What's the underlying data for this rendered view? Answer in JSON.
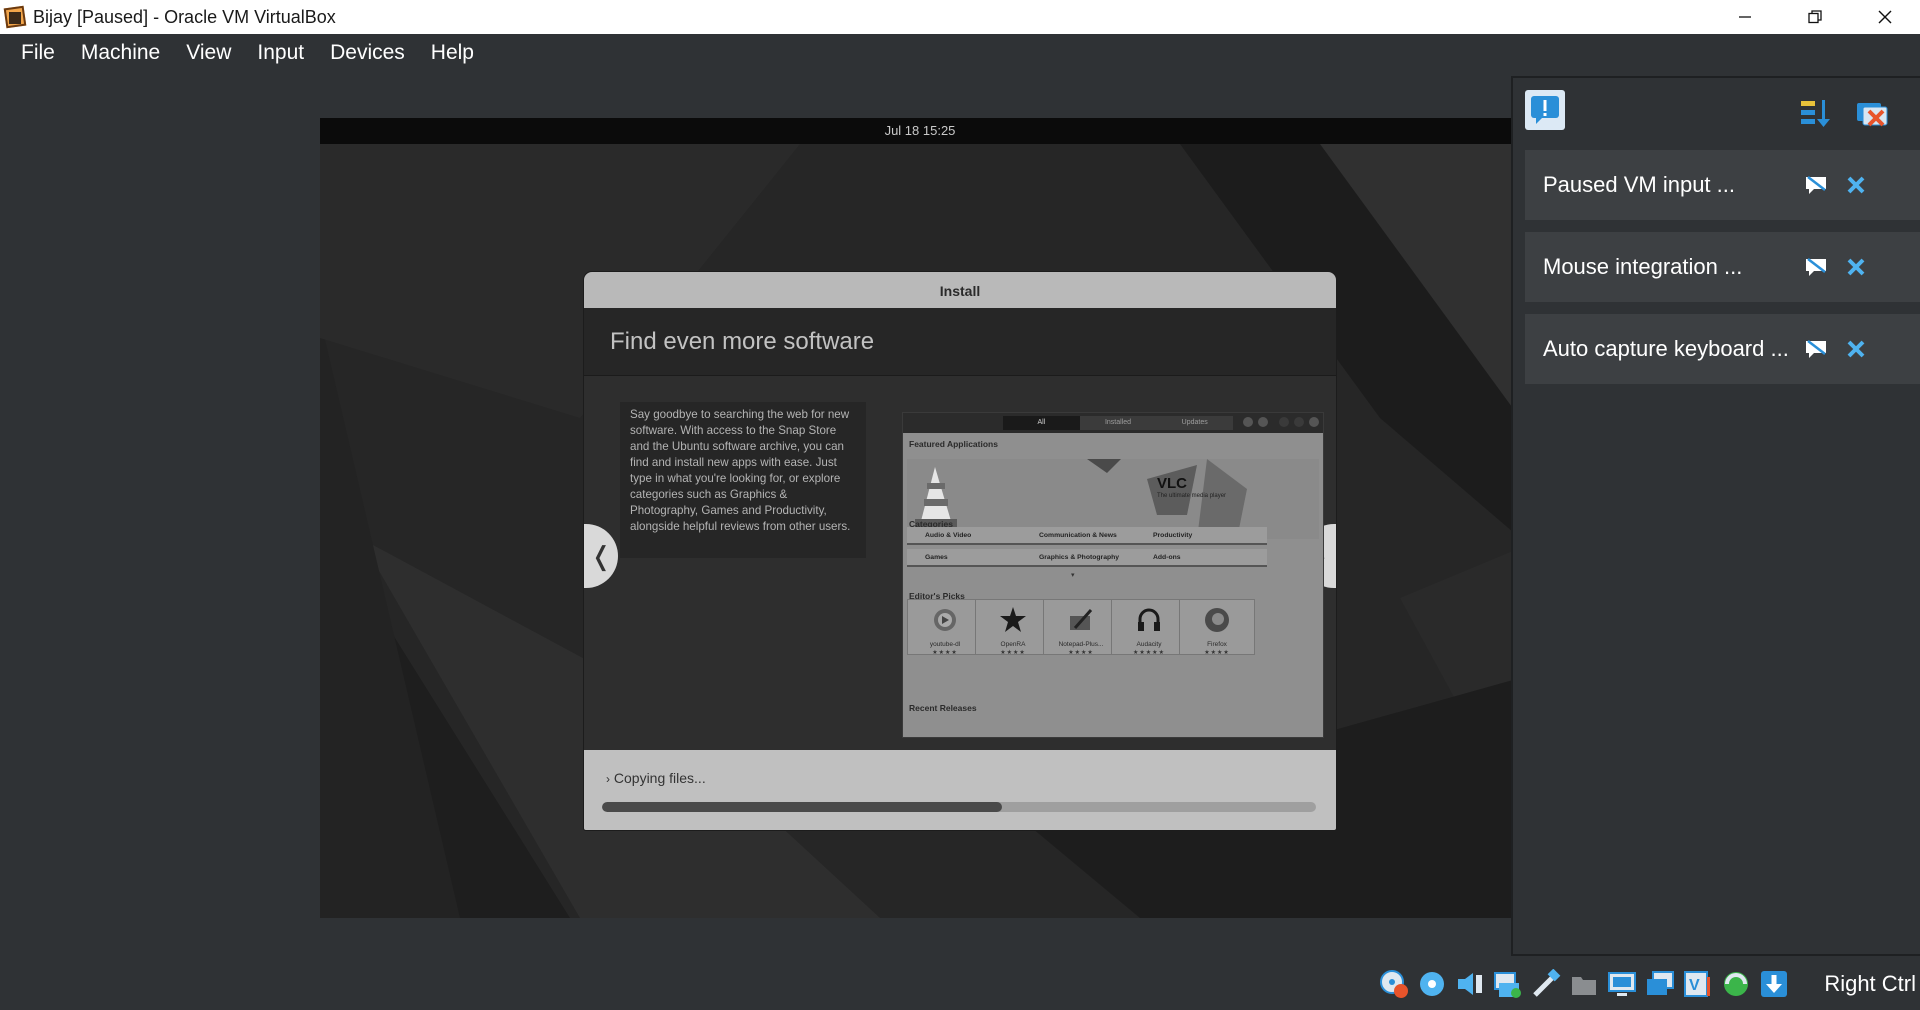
{
  "window": {
    "title": "Bijay [Paused] - Oracle VM VirtualBox",
    "controls": [
      "minimize",
      "restore",
      "close"
    ]
  },
  "menu": [
    "File",
    "Machine",
    "View",
    "Input",
    "Devices",
    "Help"
  ],
  "vm": {
    "clock": "Jul 18  15:25",
    "installer": {
      "title": "Install",
      "heading": "Find even more software",
      "description": "Say goodbye to searching the web for new software. With access to the Snap Store and the Ubuntu software archive, you can find and install new apps with ease. Just type in what you're looking for, or explore categories such as Graphics & Photography, Games and Productivity, alongside helpful reviews from other users.",
      "prev_arrow": "❬",
      "next_arrow": "❭",
      "status": "Copying files...",
      "progress": 0.56,
      "screenshot": {
        "tabs": [
          "All",
          "Installed",
          "Updates"
        ],
        "featured_label": "Featured Applications",
        "featured_app": "VLC",
        "featured_tagline": "The ultimate media player",
        "categories_label": "Categories",
        "categories": [
          "Audio & Video",
          "Communication & News",
          "Productivity",
          "Games",
          "Graphics & Photography",
          "Add-ons"
        ],
        "editors_label": "Editor's Picks",
        "picks": [
          {
            "name": "youtube-dl",
            "stars": "★★★★"
          },
          {
            "name": "OpenRA",
            "stars": "★★★★"
          },
          {
            "name": "Notepad-Plus...",
            "stars": "★★★★"
          },
          {
            "name": "Audacity",
            "stars": "★★★★★"
          },
          {
            "name": "Firefox",
            "stars": "★★★★"
          }
        ],
        "recent_label": "Recent Releases"
      }
    }
  },
  "notifications": {
    "items": [
      {
        "text": "Paused VM input ..."
      },
      {
        "text": "Mouse integration ..."
      },
      {
        "text": "Auto capture keyboard ..."
      }
    ]
  },
  "statusbar": {
    "icons": [
      "optical-drive-icon",
      "cd-icon",
      "audio-icon",
      "network-icon",
      "usb-icon",
      "shared-folders-icon",
      "display-icon",
      "capture-icon",
      "virtualization-icon",
      "cpu-icon",
      "keyboard-capture-icon"
    ],
    "host_key": "Right Ctrl"
  },
  "colors": {
    "accent": "#2a8fd8",
    "panel": "#3d4043",
    "background": "#2f3235"
  }
}
